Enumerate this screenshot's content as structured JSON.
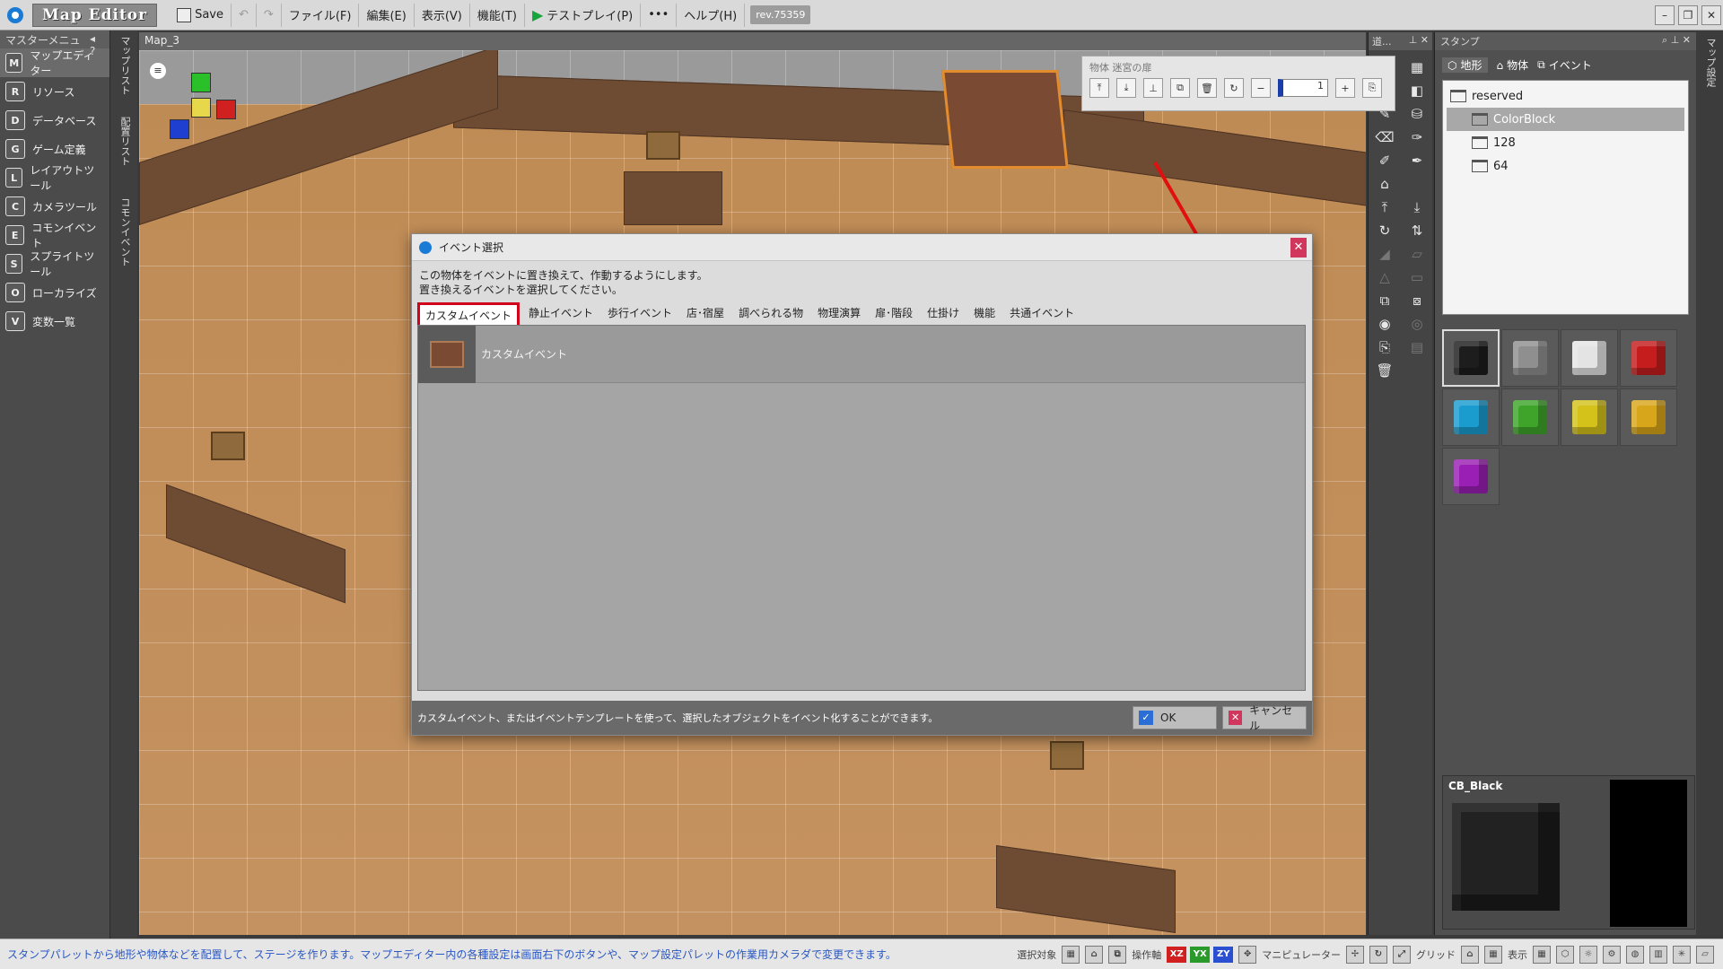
{
  "app": {
    "title": "Map Editor",
    "save_label": "Save",
    "menu": [
      "ファイル(F)",
      "編集(E)",
      "表示(V)",
      "機能(T)"
    ],
    "testplay_label": "テストプレイ(P)",
    "more_label": "•••",
    "help_label": "ヘルプ(H)",
    "revision": "rev.75359"
  },
  "master_menu": {
    "title": "マスターメニュー",
    "items": [
      {
        "label": "マップエディター",
        "icon": "M"
      },
      {
        "label": "リソース",
        "icon": "R"
      },
      {
        "label": "データベース",
        "icon": "D"
      },
      {
        "label": "ゲーム定義",
        "icon": "G"
      },
      {
        "label": "レイアウトツール",
        "icon": "L"
      },
      {
        "label": "カメラツール",
        "icon": "C"
      },
      {
        "label": "コモンイベント",
        "icon": "E"
      },
      {
        "label": "スプライトツール",
        "icon": "S"
      },
      {
        "label": "ローカライズ",
        "icon": "O"
      },
      {
        "label": "変数一覧",
        "icon": "V"
      }
    ]
  },
  "vertical_tabs": [
    "マップリスト",
    "配置リスト",
    "コモンイベント"
  ],
  "right_vertical_tab": "マップ設定",
  "map_tab": "Map_3",
  "object_toolbar": {
    "title": "物体 迷宮の扉",
    "count_value": "1"
  },
  "dialog": {
    "title": "イベント選択",
    "desc_line1": "この物体をイベントに置き換えて、作動するようにします。",
    "desc_line2": "置き換えるイベントを選択してください。",
    "tabs": [
      "カスタムイベント",
      "静止イベント",
      "歩行イベント",
      "店･宿屋",
      "調べられる物",
      "物理演算",
      "扉･階段",
      "仕掛け",
      "機能",
      "共通イベント"
    ],
    "selected_tab": "カスタムイベント",
    "list": [
      {
        "label": "カスタムイベント"
      }
    ],
    "footer_text": "カスタムイベント、またはイベントテンプレートを使って、選択したオブジェクトをイベント化することができます。",
    "ok_label": "OK",
    "cancel_label": "キャンセル"
  },
  "tool_panel": {
    "title": "道..."
  },
  "stamp": {
    "title": "スタンプ",
    "tabs": [
      "地形",
      "物体",
      "イベント"
    ],
    "tree": [
      {
        "label": "reserved",
        "level": 0
      },
      {
        "label": "ColorBlock",
        "level": 1,
        "selected": true
      },
      {
        "label": "128",
        "level": 1
      },
      {
        "label": "64",
        "level": 1
      }
    ],
    "blocks": [
      {
        "color": "#1d1d1d",
        "selected": true
      },
      {
        "color": "#8f8f8f"
      },
      {
        "color": "#e4e4e4"
      },
      {
        "color": "#c51d1d"
      },
      {
        "color": "#1a9ccf"
      },
      {
        "color": "#3fa52a"
      },
      {
        "color": "#d4c21a"
      },
      {
        "color": "#d8a61a"
      },
      {
        "color": "#9a1fb5"
      }
    ],
    "preview_name": "CB_Black"
  },
  "status": {
    "message": "スタンプパレットから地形や物体などを配置して、ステージを作ります。マップエディター内の各種設定は画面右下のボタンや、マップ設定パレットの作業用カメラダで変更できます。",
    "select_target": "選択対象",
    "axis_label": "操作軸",
    "axes": [
      {
        "label": "XZ",
        "color": "#d02020"
      },
      {
        "label": "YX",
        "color": "#2a9a2a"
      },
      {
        "label": "ZY",
        "color": "#2a4fd0"
      }
    ],
    "manipulator": "マニピュレーター",
    "grid": "グリッド",
    "display": "表示"
  }
}
